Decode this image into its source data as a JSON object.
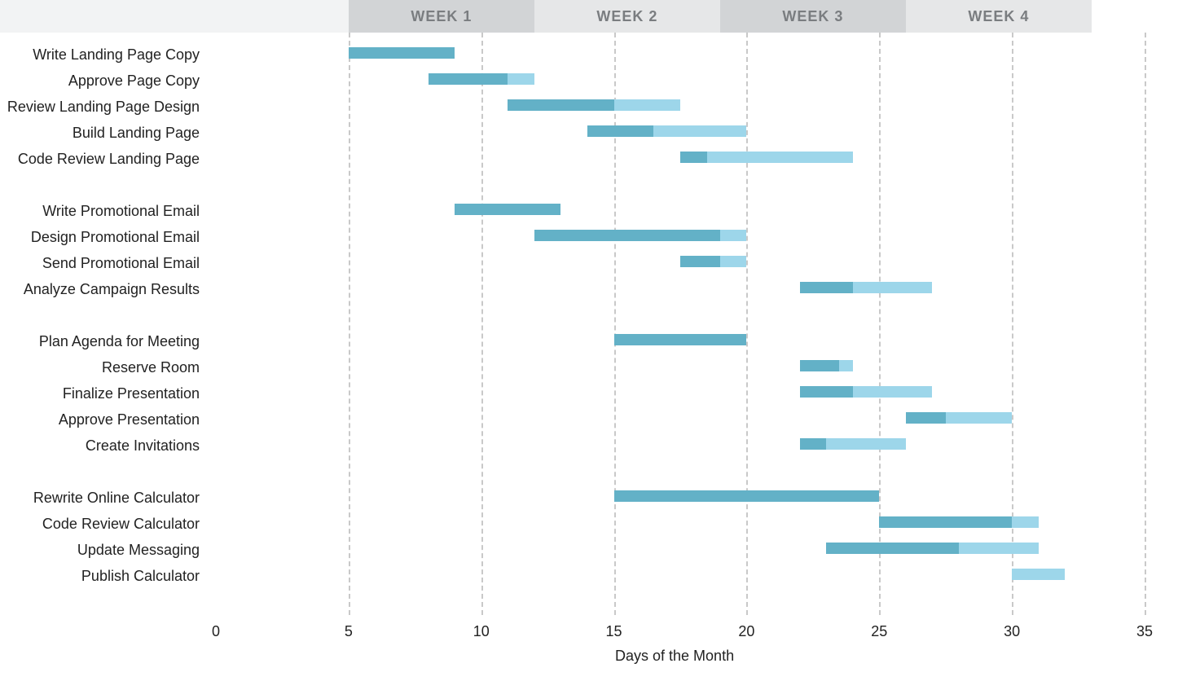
{
  "chart_data": {
    "type": "bar",
    "orientation": "horizontal",
    "xlabel": "Days of the Month",
    "ylabel": "",
    "xlim": [
      0,
      35
    ],
    "x_ticks": [
      0,
      5,
      10,
      15,
      20,
      25,
      30,
      35
    ],
    "grid_x": [
      5,
      10,
      15,
      20,
      25,
      30,
      35
    ],
    "weeks": [
      {
        "label": "WEEK 1",
        "start": 5,
        "end": 12,
        "shade": "#d2d4d6"
      },
      {
        "label": "WEEK 2",
        "start": 12,
        "end": 19,
        "shade": "#e6e7e8"
      },
      {
        "label": "WEEK 3",
        "start": 19,
        "end": 26,
        "shade": "#d2d4d6"
      },
      {
        "label": "WEEK 4",
        "start": 26,
        "end": 33,
        "shade": "#e6e7e8"
      }
    ],
    "colors": {
      "primary": "#63b1c7",
      "secondary": "#9dd6ea",
      "grid": "#c9c9c9"
    },
    "tasks": [
      {
        "name": "Write Landing Page Copy",
        "start": 5,
        "p_end": 9,
        "s_end": 9
      },
      {
        "name": "Approve Page Copy",
        "start": 8,
        "p_end": 11,
        "s_end": 12
      },
      {
        "name": "Review Landing Page Design",
        "start": 11,
        "p_end": 15,
        "s_end": 17.5
      },
      {
        "name": "Build Landing Page",
        "start": 14,
        "p_end": 16.5,
        "s_end": 20
      },
      {
        "name": "Code Review Landing Page",
        "start": 17.5,
        "p_end": 18.5,
        "s_end": 24
      },
      {
        "name": "__gap__"
      },
      {
        "name": "Write Promotional Email",
        "start": 9,
        "p_end": 13,
        "s_end": 13
      },
      {
        "name": "Design Promotional Email",
        "start": 12,
        "p_end": 19,
        "s_end": 20
      },
      {
        "name": "Send Promotional Email",
        "start": 17.5,
        "p_end": 19,
        "s_end": 20
      },
      {
        "name": "Analyze Campaign Results",
        "start": 22,
        "p_end": 24,
        "s_end": 27
      },
      {
        "name": "__gap__"
      },
      {
        "name": "Plan Agenda for Meeting",
        "start": 15,
        "p_end": 20,
        "s_end": 20
      },
      {
        "name": "Reserve Room",
        "start": 22,
        "p_end": 23.5,
        "s_end": 24
      },
      {
        "name": "Finalize Presentation",
        "start": 22,
        "p_end": 24,
        "s_end": 27
      },
      {
        "name": "Approve Presentation",
        "start": 26,
        "p_end": 27.5,
        "s_end": 30
      },
      {
        "name": "Create Invitations",
        "start": 22,
        "p_end": 23,
        "s_end": 26
      },
      {
        "name": "__gap__"
      },
      {
        "name": "Rewrite Online Calculator",
        "start": 15,
        "p_end": 25,
        "s_end": 25
      },
      {
        "name": "Code Review Calculator",
        "start": 25,
        "p_end": 30,
        "s_end": 31
      },
      {
        "name": "Update Messaging",
        "start": 23,
        "p_end": 28,
        "s_end": 31
      },
      {
        "name": "Publish Calculator",
        "start": 30,
        "p_end": 30,
        "s_end": 32
      }
    ]
  }
}
